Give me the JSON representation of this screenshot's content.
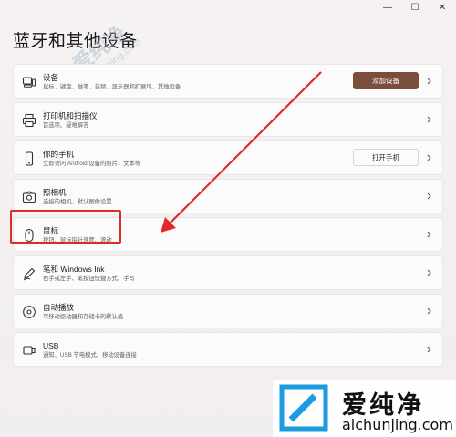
{
  "window": {
    "minimize": "—",
    "maximize": "☐",
    "close": "✕"
  },
  "page": {
    "title": "蓝牙和其他设备"
  },
  "rows": [
    {
      "title": "设备",
      "subtitle": "鼠标、键盘、触笔、音频、显示器和扩展坞、其他设备",
      "icon": "devices-icon",
      "action": "添加设备"
    },
    {
      "title": "打印机和扫描仪",
      "subtitle": "首选项、疑难解答",
      "icon": "printer-icon"
    },
    {
      "title": "你的手机",
      "subtitle": "立即访问 Android 设备的照片、文本等",
      "icon": "phone-icon",
      "action": "打开手机"
    },
    {
      "title": "照相机",
      "subtitle": "连接的相机、默认图像设置",
      "icon": "camera-icon"
    },
    {
      "title": "鼠标",
      "subtitle": "按钮、鼠标指针速度、滚动",
      "icon": "mouse-icon"
    },
    {
      "title": "笔和 Windows Ink",
      "subtitle": "右手或左手、笔按钮快捷方式、手写",
      "icon": "pen-icon"
    },
    {
      "title": "自动播放",
      "subtitle": "可移动驱动器和存储卡的默认值",
      "icon": "autoplay-icon"
    },
    {
      "title": "USB",
      "subtitle": "通知、USB 节电模式、移动设备连接",
      "icon": "usb-icon"
    }
  ],
  "watermark": {
    "text": "爱纯净",
    "url": "aichunjing.com"
  },
  "logo": {
    "name": "爱纯净",
    "url": "aichunjing.com"
  },
  "colors": {
    "accent": "#7a4e3d",
    "highlight": "#e02a2a"
  }
}
